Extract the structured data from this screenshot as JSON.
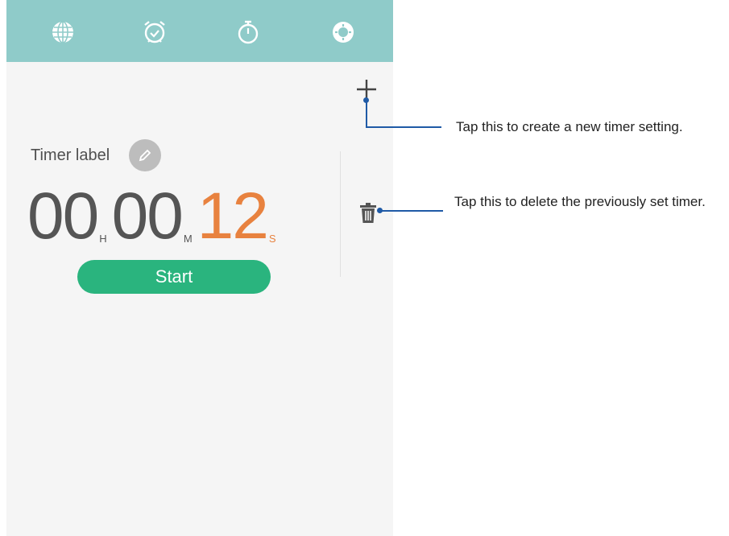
{
  "tabs": [
    {
      "name": "World clock",
      "icon": "globe-icon"
    },
    {
      "name": "Alarm",
      "icon": "alarm-clock-icon"
    },
    {
      "name": "Stopwatch",
      "icon": "stopwatch-icon"
    },
    {
      "name": "Timer",
      "icon": "timer-icon",
      "active": true
    }
  ],
  "timer": {
    "label": "Timer label",
    "hours": "00",
    "hours_unit": "H",
    "minutes": "00",
    "minutes_unit": "M",
    "seconds": "12",
    "seconds_unit": "S",
    "start_label": "Start"
  },
  "callouts": {
    "add": "Tap this to create a new timer setting.",
    "delete": "Tap this to delete the previously set timer."
  },
  "colors": {
    "topbar": "#8fcbc9",
    "start_button": "#2ab47e",
    "seconds": "#e8823f",
    "callout_line": "#1f5aa6"
  }
}
